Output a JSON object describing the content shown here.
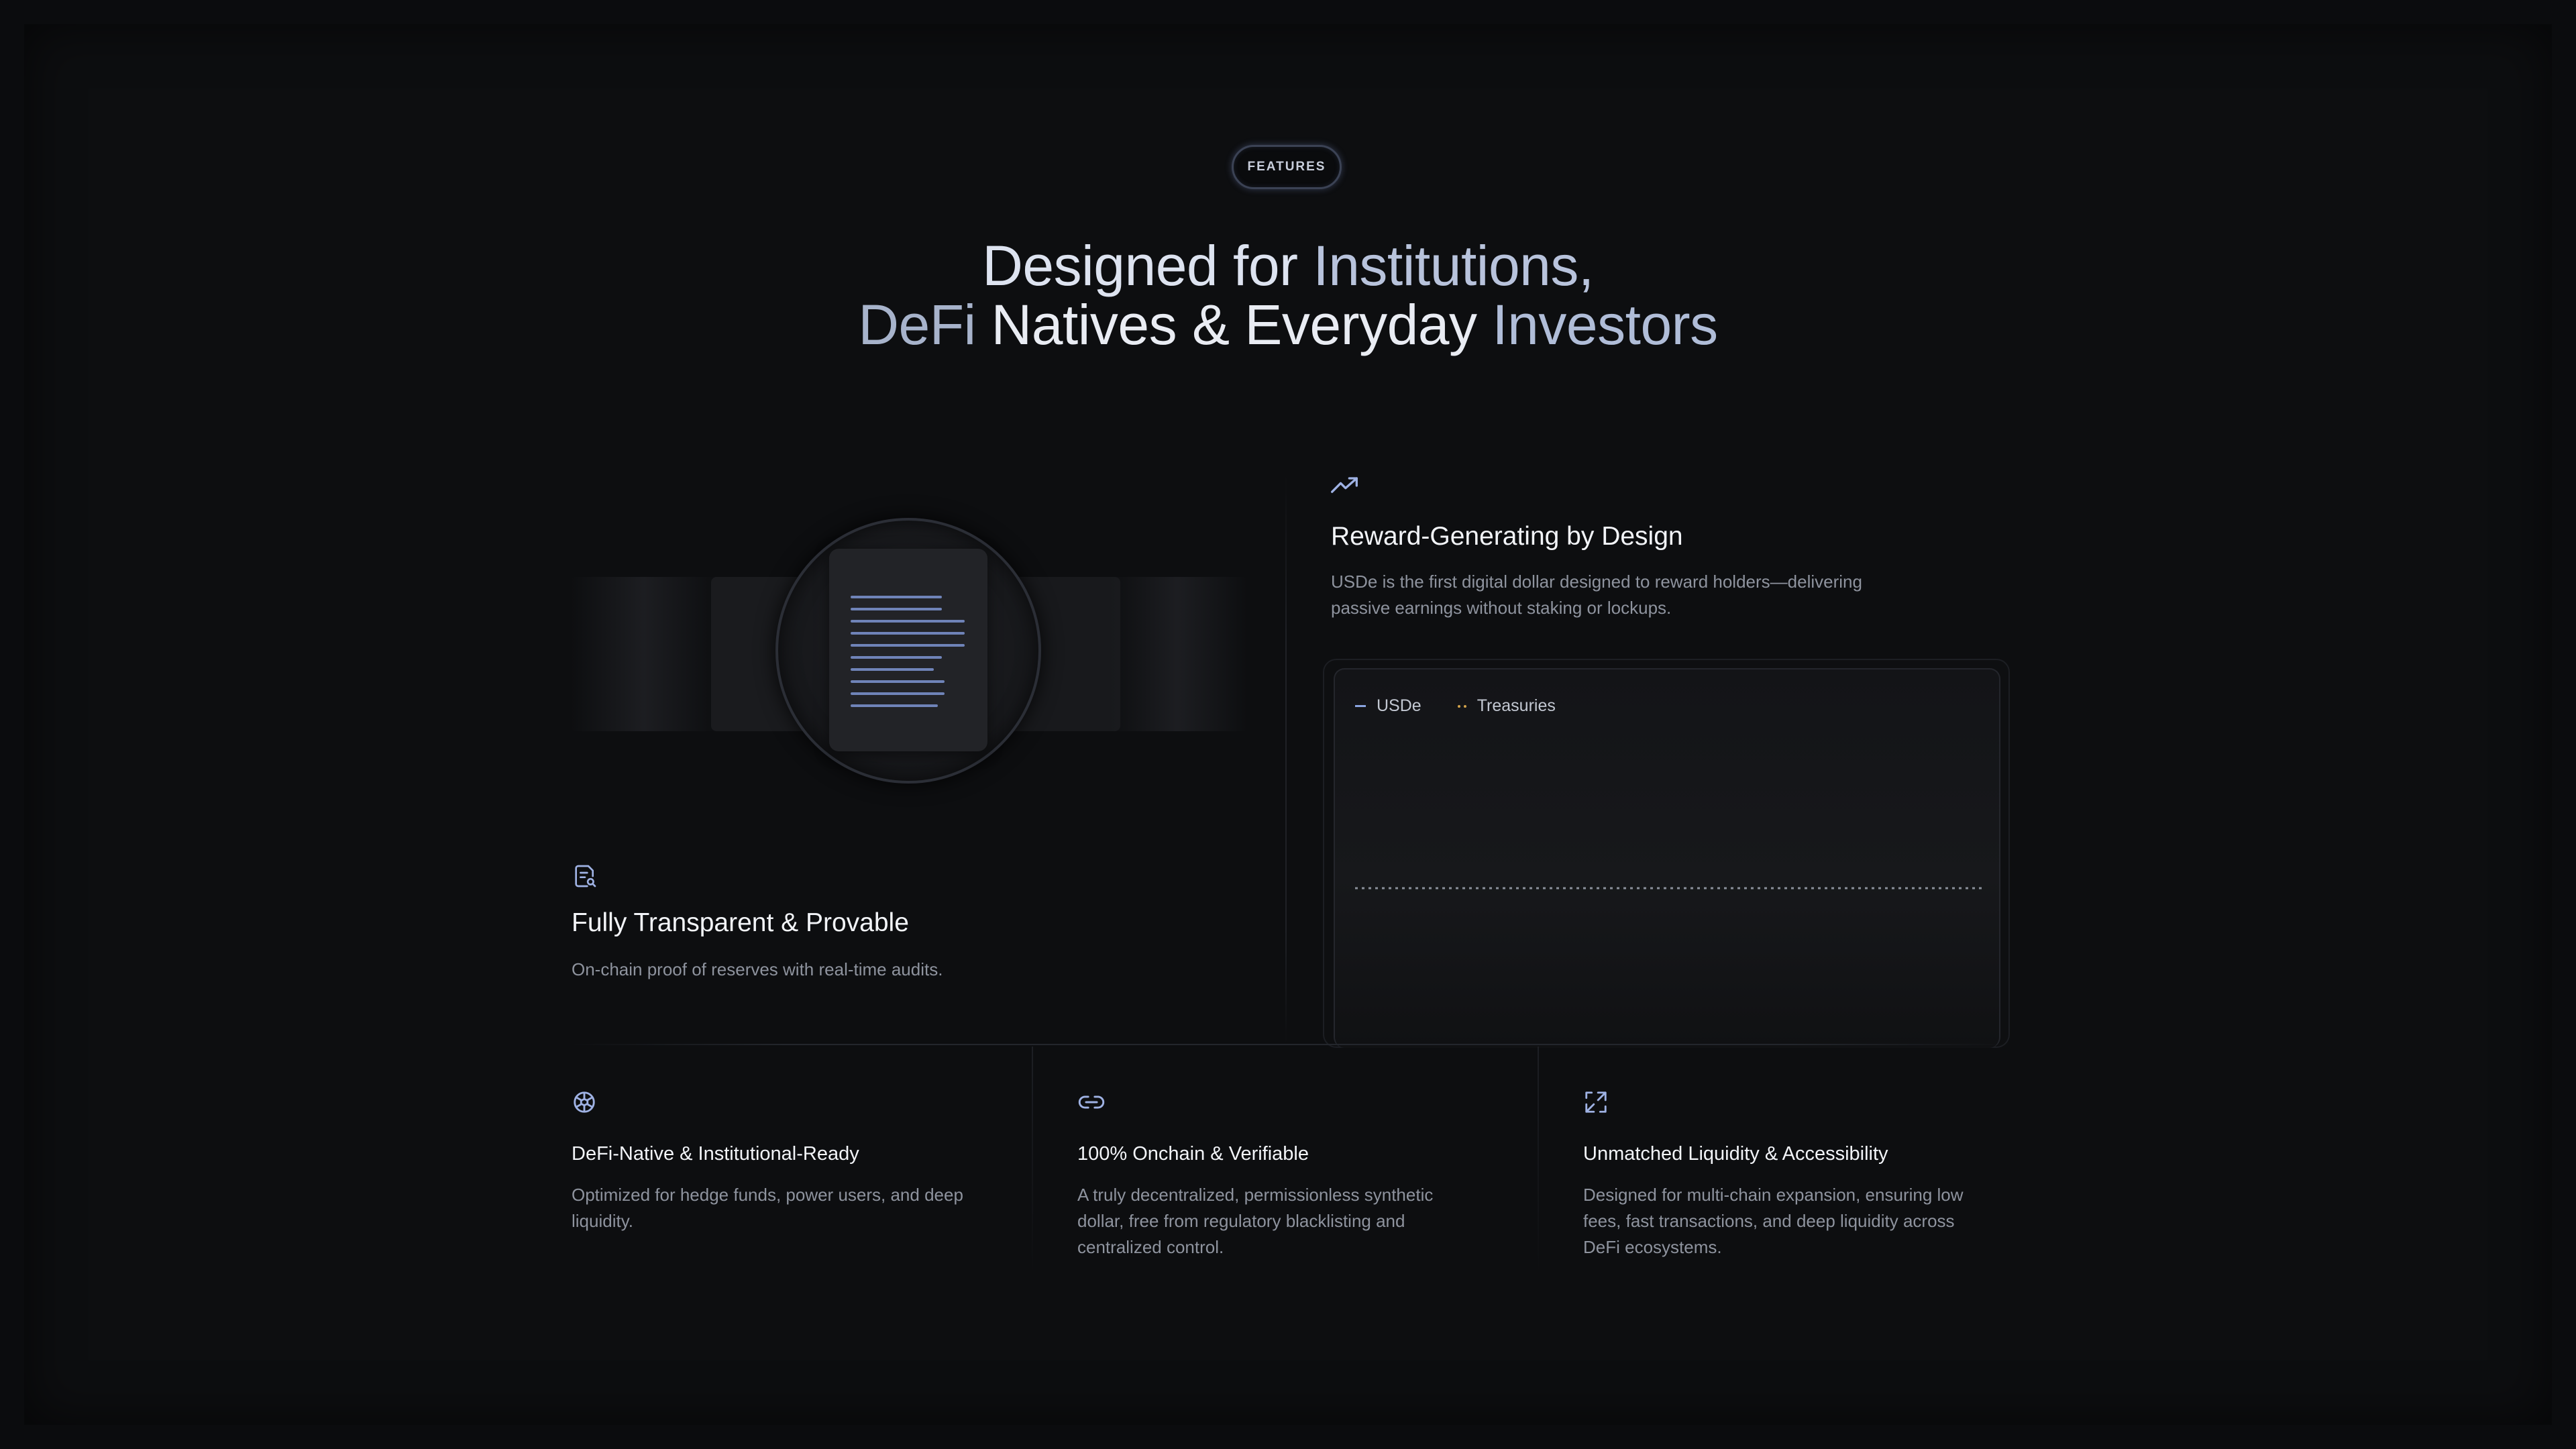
{
  "badge": "FEATURES",
  "headline": {
    "line1_a": "Designed for",
    "line1_b": "Institutions,",
    "line2_a": "DeFi",
    "line2_b": "Natives & Everyday",
    "line2_c": "Investors"
  },
  "features": {
    "transparent": {
      "icon": "document-search-icon",
      "title": "Fully Transparent & Provable",
      "description": "On-chain proof of reserves with real-time audits."
    },
    "reward": {
      "icon": "trending-up-icon",
      "title": "Reward-Generating by Design",
      "description_line1": "USDe is the first digital dollar designed to reward holders—delivering",
      "description_line2": "passive earnings without staking or lockups.",
      "legend": [
        "USDe",
        "Treasuries"
      ]
    }
  },
  "cards": [
    {
      "icon": "cube-network-icon",
      "title": "DeFi-Native & Institutional-Ready",
      "description_line1": "Optimized for hedge funds, power users, and deep",
      "description_line2": "liquidity."
    },
    {
      "icon": "chain-link-icon",
      "title": "100% Onchain & Verifiable",
      "description_line1": "A truly decentralized, permissionless synthetic",
      "description_line2": "dollar, free from regulatory blacklisting and",
      "description_line3": "centralized control."
    },
    {
      "icon": "expand-arrows-icon",
      "title": "Unmatched Liquidity & Accessibility",
      "description_line1": "Designed for multi-chain expansion, ensuring low",
      "description_line2": "fees, fast transactions, and deep liquidity across",
      "description_line3": "DeFi ecosystems."
    }
  ],
  "colors": {
    "background": "#0d0e10",
    "accent_blue": "#8aa4e0",
    "treasuries_gold": "#d2a24a",
    "text_muted": "#8e939e"
  }
}
